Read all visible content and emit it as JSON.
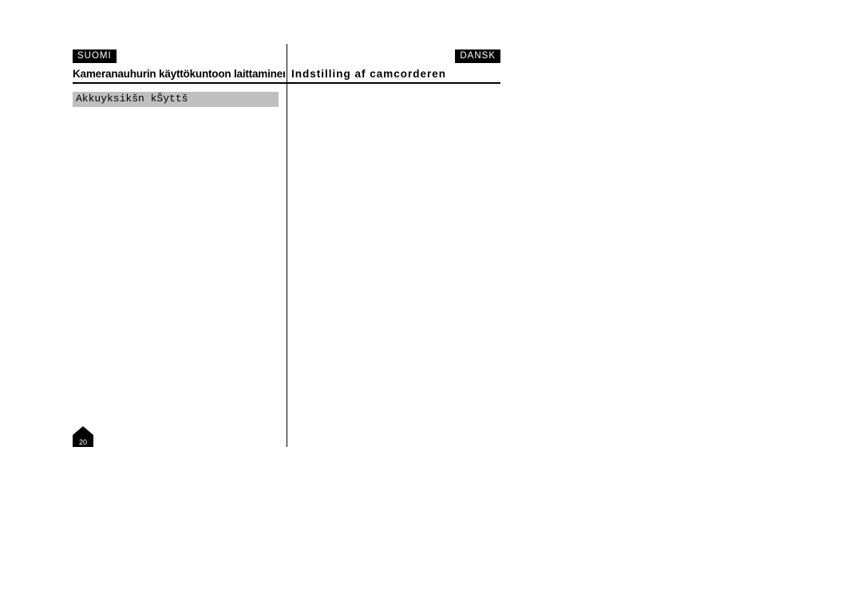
{
  "labels": {
    "left_language": "SUOMI",
    "right_language": "DANSK"
  },
  "headings": {
    "left": "Kameranauhurin käyttökuntoon laittaminen",
    "right": "Indstilling af camcorderen"
  },
  "subheading": {
    "left": "Akkuyksikšn kŠyttš"
  },
  "page_number": "20"
}
